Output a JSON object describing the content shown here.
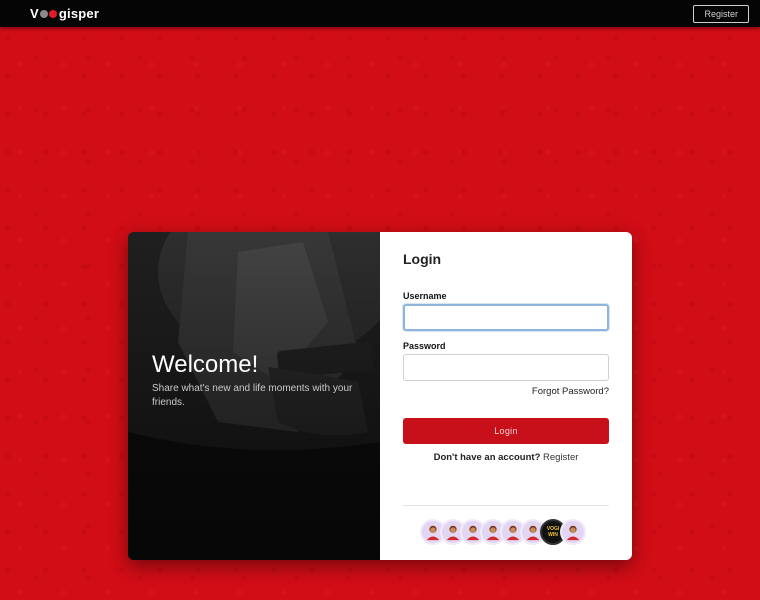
{
  "navbar": {
    "logo_prefix": "V",
    "logo_suffix": "gisper",
    "register_label": "Register"
  },
  "welcome": {
    "title": "Welcome!",
    "text": "Share what's new and life moments with your friends."
  },
  "login": {
    "title": "Login",
    "username_label": "Username",
    "username_value": "",
    "password_label": "Password",
    "password_value": "",
    "forgot_label": "Forgot Password?",
    "button_label": "Login",
    "no_account_text": "Don't have an account?",
    "register_link": "Register"
  },
  "avatars": {
    "count": 8,
    "badge_text": "VOGI WIN"
  },
  "colors": {
    "brand_red": "#d10d16",
    "button_red": "#c8101a",
    "navbar_bg": "#050505"
  }
}
